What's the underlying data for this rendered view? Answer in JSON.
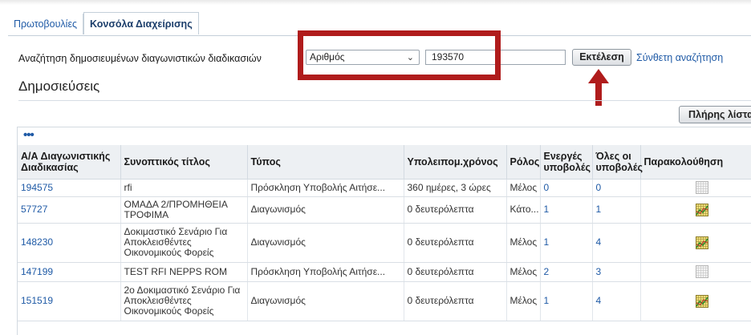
{
  "tabs": [
    {
      "label": "Πρωτοβουλίες",
      "active": false
    },
    {
      "label": "Κονσόλα Διαχείρισης",
      "active": true
    }
  ],
  "search": {
    "label": "Αναζήτηση δημοσιευμένων διαγωνιστικών διαδικασιών",
    "field_selected": "Αριθμός",
    "value": "193570",
    "run_label": "Εκτέλεση",
    "advanced_label": "Σύνθετη αναζήτηση"
  },
  "section": {
    "title": "Δημοσιεύσεις",
    "full_list_label": "Πλήρης λίστα",
    "more_icon": "•••"
  },
  "colors": {
    "highlight": "#b01c1c",
    "link": "#1f5aa6",
    "header_bg": "#edf0f3"
  },
  "table": {
    "columns": [
      "Α/Α Διαγωνιστικής Διαδικασίας",
      "Συνοπτικός τίτλος",
      "Τύπος",
      "Υπολειπομ.χρόνος",
      "Ρόλος",
      "Ενεργές υποβολές",
      "Όλες οι υποβολές",
      "Παρακολούθηση"
    ],
    "rows": [
      {
        "id": "194575",
        "title": "rfi",
        "type": "Πρόσκληση Υποβολής Αιτήσε...",
        "time": "360 ημέρες, 3 ώρες",
        "role": "Μέλος",
        "active": "0",
        "all": "0",
        "monitor_icon": "grid-gray-icon"
      },
      {
        "id": "57727",
        "title": "ΟΜΑΔΑ 2/ΠΡΟΜΗΘΕΙΑ ΤΡΟΦΙΜΑ",
        "type": "Διαγωνισμός",
        "time": "0 δευτερόλεπτα",
        "role": "Κάτο...",
        "active": "1",
        "all": "1",
        "monitor_icon": "grid-chart-icon"
      },
      {
        "id": "148230",
        "title": "Δοκιμαστικό Σενάριο Για Αποκλεισθέντες Οικονομικούς Φορείς",
        "type": "Διαγωνισμός",
        "time": "0 δευτερόλεπτα",
        "role": "Μέλος",
        "active": "1",
        "all": "4",
        "monitor_icon": "grid-chart-icon"
      },
      {
        "id": "147199",
        "title": "TEST RFI NEPPS ROM",
        "type": "Πρόσκληση Υποβολής Αιτήσε...",
        "time": "0 δευτερόλεπτα",
        "role": "Μέλος",
        "active": "2",
        "all": "3",
        "monitor_icon": "grid-gray-icon"
      },
      {
        "id": "151519",
        "title": "2ο Δοκιμαστικό Σενάριο Για Αποκλεισθέντες Οικονομικούς Φορείς",
        "type": "Διαγωνισμός",
        "time": "0 δευτερόλεπτα",
        "role": "Μέλος",
        "active": "1",
        "all": "4",
        "monitor_icon": "grid-chart-icon"
      }
    ]
  }
}
